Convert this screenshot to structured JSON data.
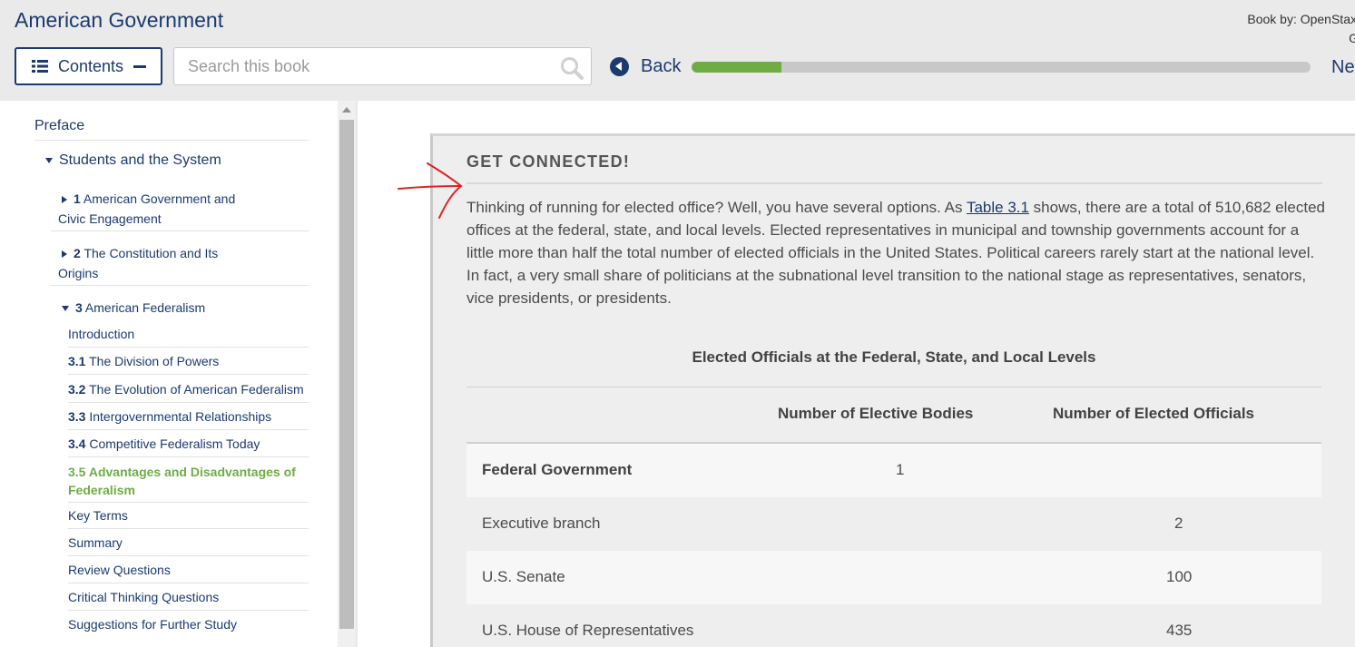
{
  "header": {
    "book_title": "American Government",
    "book_by_line1": "Book by: OpenStax",
    "book_by_line2": "G",
    "contents_label": "Contents",
    "search_placeholder": "Search this book",
    "back_label": "Back",
    "next_label": "Ne",
    "progress_fraction": 0.145,
    "accent_color": "#1c3a6e",
    "progress_color": "#6fac46"
  },
  "sidebar": {
    "items": [
      {
        "num": "",
        "label": "Preface"
      },
      {
        "num": "",
        "label": "Students and the System"
      },
      {
        "num": "1",
        "label": "American Government and",
        "label2": "Civic Engagement"
      },
      {
        "num": "2",
        "label": "The Constitution and Its",
        "label2": "Origins"
      },
      {
        "num": "3",
        "label": "American Federalism"
      },
      {
        "num": "",
        "label": "Introduction"
      },
      {
        "num": "3.1",
        "label": "The Division of Powers"
      },
      {
        "num": "3.2",
        "label": "The Evolution of American Federalism"
      },
      {
        "num": "3.3",
        "label": "Intergovernmental Relationships"
      },
      {
        "num": "3.4",
        "label": "Competitive Federalism Today"
      },
      {
        "num": "3.5",
        "label": "Advantages and Disadvantages of",
        "label2": "Federalism"
      },
      {
        "num": "",
        "label": "Key Terms"
      },
      {
        "num": "",
        "label": "Summary"
      },
      {
        "num": "",
        "label": "Review Questions"
      },
      {
        "num": "",
        "label": "Critical Thinking Questions"
      },
      {
        "num": "",
        "label": "Suggestions for Further Study"
      }
    ]
  },
  "feature": {
    "title": "GET CONNECTED!",
    "body_before_link": "Thinking of running for elected office? Well, you have several options. As ",
    "link": "Table 3.1",
    "body_after_link": " shows, there are a total of 510,682 elected offices at the federal, state, and local levels. Elected representatives in municipal and township governments account for a little more than half the total number of elected officials in the United States. Political careers rarely start at the national level. In fact, a very small share of politicians at the subnational level transition to the national stage as representatives, senators, vice presidents, or presidents."
  },
  "table": {
    "caption": "Elected Officials at the Federal, State, and Local Levels",
    "columns": [
      "",
      "Number of Elective Bodies",
      "Number of Elected Officials"
    ],
    "rows": [
      {
        "label": "Federal Government",
        "bodies": "1",
        "officials": ""
      },
      {
        "label": "Executive branch",
        "bodies": "",
        "officials": "2"
      },
      {
        "label": "U.S. Senate",
        "bodies": "",
        "officials": "100"
      },
      {
        "label": "U.S. House of Representatives",
        "bodies": "",
        "officials": "435"
      }
    ]
  }
}
